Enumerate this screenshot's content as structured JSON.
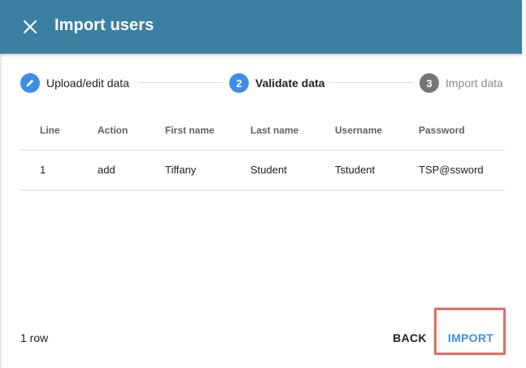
{
  "header": {
    "title": "Import users",
    "close_icon": "close-icon",
    "background_color": "#3b80a3"
  },
  "stepper": {
    "steps": [
      {
        "number": "1",
        "label": "Upload/edit data",
        "state": "completed",
        "icon": "pencil-icon"
      },
      {
        "number": "2",
        "label": "Validate data",
        "state": "active"
      },
      {
        "number": "3",
        "label": "Import data",
        "state": "inactive"
      }
    ],
    "active_color": "#3c8ee8"
  },
  "table": {
    "columns": [
      "Line",
      "Action",
      "First name",
      "Last name",
      "Username",
      "Password"
    ],
    "rows": [
      {
        "line": "1",
        "action": "add",
        "first_name": "Tiffany",
        "last_name": "Student",
        "username": "Tstudent",
        "password": "TSP@ssword"
      }
    ]
  },
  "footer": {
    "row_count": "1 row",
    "back_label": "BACK",
    "import_label": "IMPORT",
    "highlight_color": "#e07066"
  }
}
